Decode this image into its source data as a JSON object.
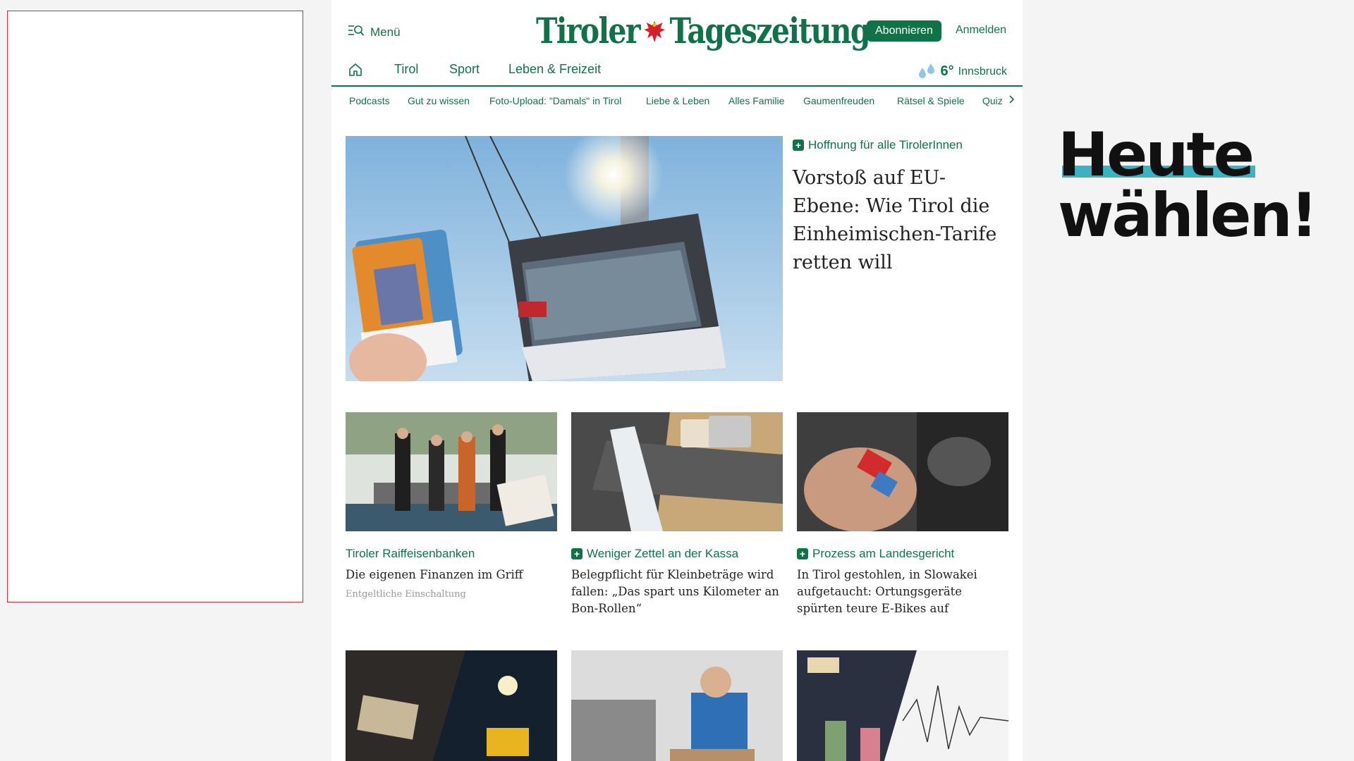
{
  "header": {
    "menu_label": "Menü",
    "logo_left": "Tiroler",
    "logo_right": "Tageszeitung",
    "subscribe_label": "Abonnieren",
    "login_label": "Anmelden"
  },
  "nav": {
    "items": [
      {
        "label": "Tirol"
      },
      {
        "label": "Sport"
      },
      {
        "label": "Leben & Freizeit"
      }
    ],
    "weather": {
      "temp": "6°",
      "city": "Innsbruck"
    }
  },
  "subnav": {
    "items": [
      {
        "label": "Podcasts"
      },
      {
        "label": "Gut zu wissen"
      },
      {
        "label": "Foto-Upload: \"Damals\" in Tirol"
      },
      {
        "label": "Liebe & Leben"
      },
      {
        "label": "Alles Familie"
      },
      {
        "label": "Gaumenfreuden"
      },
      {
        "label": "Rätsel & Spiele"
      },
      {
        "label": "Quiz"
      }
    ]
  },
  "hero": {
    "kicker": "Hoffnung für alle TirolerInnen",
    "title": "Vorstoß auf EU-Ebene: Wie Tirol die Einheimischen-Tarife retten will"
  },
  "cards": [
    {
      "kicker": "Tiroler Raiffeisenbanken",
      "title": "Die eigenen Finanzen im Griff",
      "sponsor": "Entgeltliche Einschaltung"
    },
    {
      "kicker": "Weniger Zettel an der Kassa",
      "title": "Belegpflicht für Kleinbeträge wird fallen: „Das spart uns Kilometer an Bon-Rollen“"
    },
    {
      "kicker": "Prozess am Landesgericht",
      "title": "In Tirol gestohlen, in Slowakei aufgetaucht: Ortungsgeräte spürten teure E-Bikes auf"
    }
  ],
  "ad": {
    "line1": "Heute",
    "line2": "wählen!",
    "accent_color": "#3bb2c4"
  },
  "colors": {
    "brand": "#11724a",
    "ad_border": "#c83040"
  }
}
